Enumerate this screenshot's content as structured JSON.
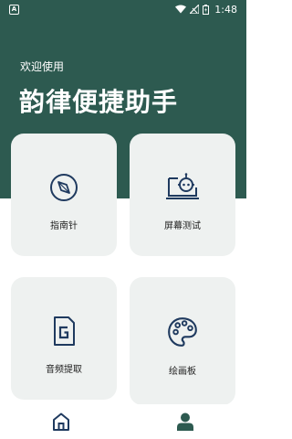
{
  "status_bar": {
    "notification_icon": "A",
    "icons": [
      "wifi-icon",
      "signal-icon",
      "battery-icon"
    ],
    "time": "1:48"
  },
  "header": {
    "welcome": "欢迎使用",
    "title": "韵律便捷助手",
    "background_color": "#2d5a50"
  },
  "cards": [
    {
      "label": "指南针",
      "icon": "compass-icon"
    },
    {
      "label": "屏幕测试",
      "icon": "robot-laptop-icon"
    },
    {
      "label": "音频提取",
      "icon": "g-document-icon"
    },
    {
      "label": "绘画板",
      "icon": "palette-icon"
    }
  ],
  "bottom_nav": {
    "items": [
      "home-icon",
      "profile-icon"
    ]
  },
  "colors": {
    "icon": "#1f3a5f",
    "card": "#eef1f0",
    "accent": "#2d5a50"
  }
}
